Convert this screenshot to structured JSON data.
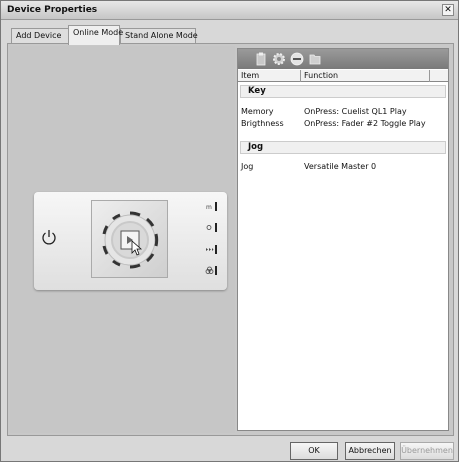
{
  "window": {
    "title": "Device Properties",
    "close_glyph": "✕"
  },
  "tabs": [
    {
      "label": "Add Device"
    },
    {
      "label": "Online Mode"
    },
    {
      "label": "Stand Alone Mode"
    }
  ],
  "grid": {
    "columns": {
      "item": "Item",
      "function": "Function"
    },
    "groups": [
      {
        "name": "Key",
        "rows": [
          {
            "item": "Memory",
            "function": "OnPress: Cuelist QL1   Play"
          },
          {
            "item": "Brigthness",
            "function": "OnPress: Fader #2 Toggle Play"
          }
        ]
      },
      {
        "name": "Jog",
        "rows": [
          {
            "item": "Jog",
            "function": "Versatile Master 0"
          }
        ]
      }
    ]
  },
  "toolbar_icons": [
    "clipboard-icon",
    "gear-icon",
    "no-entry-icon",
    "folder-icon"
  ],
  "device_icons": [
    "power-icon",
    "memory-icon",
    "brightness-icon",
    "play-icon",
    "group-icon"
  ],
  "buttons": {
    "ok": "OK",
    "cancel": "Abbrechen",
    "apply": "Übernehmen"
  }
}
